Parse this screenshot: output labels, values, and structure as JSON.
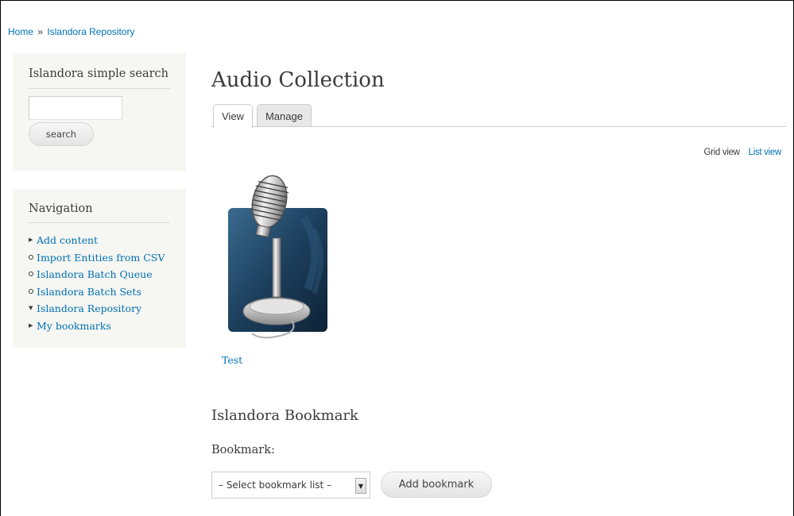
{
  "breadcrumb": {
    "home": "Home",
    "separator": "»",
    "current": "Islandora Repository"
  },
  "search_block": {
    "title": "Islandora simple search",
    "input_value": "",
    "button_label": "search"
  },
  "navigation": {
    "title": "Navigation",
    "items": [
      {
        "label": "Add content",
        "bullet": "triangle-right"
      },
      {
        "label": "Import Entities from CSV",
        "bullet": "circle"
      },
      {
        "label": "Islandora Batch Queue",
        "bullet": "circle"
      },
      {
        "label": "Islandora Batch Sets",
        "bullet": "circle"
      },
      {
        "label": "Islandora Repository",
        "bullet": "triangle-down"
      },
      {
        "label": "My bookmarks",
        "bullet": "triangle-right"
      }
    ]
  },
  "main": {
    "title": "Audio Collection",
    "tabs": [
      {
        "label": "View",
        "active": true
      },
      {
        "label": "Manage",
        "active": false
      }
    ],
    "view_switch": {
      "grid": "Grid view",
      "list": "List view"
    },
    "object": {
      "label": "Test",
      "thumbnail_icon": "microphone-icon"
    }
  },
  "bookmark": {
    "heading": "Islandora Bookmark",
    "label": "Bookmark:",
    "select_value": "– Select bookmark list –",
    "button_label": "Add bookmark"
  },
  "colors": {
    "link": "#0071b3",
    "text": "#3b3b3b",
    "sidebar_bg": "#f6f6f2",
    "thumb_bg": "#1a3a56"
  }
}
